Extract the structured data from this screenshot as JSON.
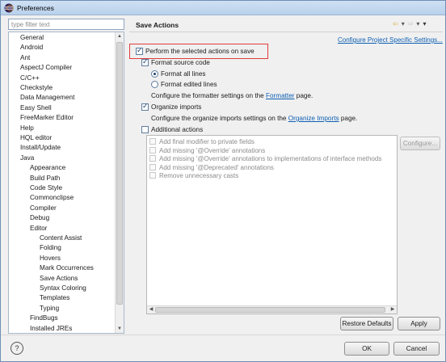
{
  "window": {
    "title": "Preferences",
    "app_icon": "eclipse-icon"
  },
  "filter": {
    "placeholder": "type filter text"
  },
  "tree": {
    "items": [
      {
        "label": "General",
        "level": 0
      },
      {
        "label": "Android",
        "level": 0
      },
      {
        "label": "Ant",
        "level": 0
      },
      {
        "label": "AspectJ Compiler",
        "level": 0
      },
      {
        "label": "C/C++",
        "level": 0
      },
      {
        "label": "Checkstyle",
        "level": 0
      },
      {
        "label": "Data Management",
        "level": 0
      },
      {
        "label": "Easy Shell",
        "level": 0
      },
      {
        "label": "FreeMarker Editor",
        "level": 0
      },
      {
        "label": "Help",
        "level": 0
      },
      {
        "label": "HQL editor",
        "level": 0
      },
      {
        "label": "Install/Update",
        "level": 0
      },
      {
        "label": "Java",
        "level": 0
      },
      {
        "label": "Appearance",
        "level": 1
      },
      {
        "label": "Build Path",
        "level": 1
      },
      {
        "label": "Code Style",
        "level": 1
      },
      {
        "label": "Commonclipse",
        "level": 1
      },
      {
        "label": "Compiler",
        "level": 1
      },
      {
        "label": "Debug",
        "level": 1
      },
      {
        "label": "Editor",
        "level": 1
      },
      {
        "label": "Content Assist",
        "level": 2
      },
      {
        "label": "Folding",
        "level": 2
      },
      {
        "label": "Hovers",
        "level": 2
      },
      {
        "label": "Mark Occurrences",
        "level": 2
      },
      {
        "label": "Save Actions",
        "level": 2
      },
      {
        "label": "Syntax Coloring",
        "level": 2
      },
      {
        "label": "Templates",
        "level": 2
      },
      {
        "label": "Typing",
        "level": 2
      },
      {
        "label": "FindBugs",
        "level": 1
      },
      {
        "label": "Installed JREs",
        "level": 1
      }
    ]
  },
  "page": {
    "title": "Save Actions",
    "configure_link": "Configure Project Specific Settings...",
    "perform_label": "Perform the selected actions on save",
    "perform_checked": true,
    "format_label": "Format source code",
    "format_checked": true,
    "format_all_label": "Format all lines",
    "format_edited_label": "Format edited lines",
    "format_hint_pre": "Configure the formatter settings on the ",
    "format_hint_link": "Formatter",
    "format_hint_post": " page.",
    "organize_label": "Organize imports",
    "organize_checked": true,
    "organize_hint_pre": "Configure the organize imports settings on the ",
    "organize_hint_link": "Organize Imports",
    "organize_hint_post": " page.",
    "additional_label": "Additional actions",
    "additional_checked": false,
    "actions": [
      "Add final modifier to private fields",
      "Add missing '@Override' annotations",
      "Add missing '@Override' annotations to implementations of interface methods",
      "Add missing '@Deprecated' annotations",
      "Remove unnecessary casts"
    ],
    "configure_button": "Configure..."
  },
  "buttons": {
    "restore": "Restore Defaults",
    "apply": "Apply",
    "ok": "OK",
    "cancel": "Cancel",
    "help": "?"
  }
}
